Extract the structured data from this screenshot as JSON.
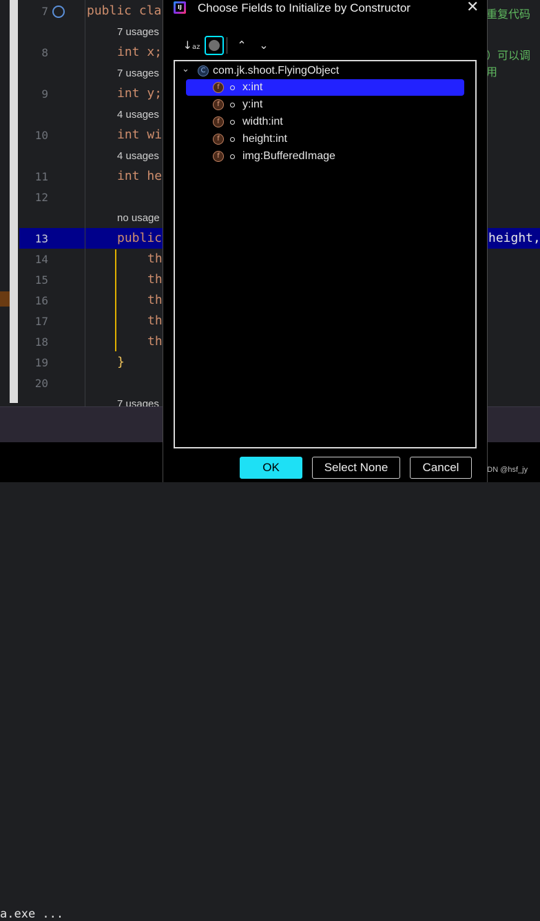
{
  "editor": {
    "lines": [
      {
        "no": "7",
        "code_kw": "public",
        "code_rest": " cla",
        "hint": null
      },
      {
        "no": "8",
        "code_kw": "int",
        "code_rest": " x;"
      },
      {
        "no": "9",
        "code_kw": "int",
        "code_rest": " y;"
      },
      {
        "no": "10",
        "code_kw": "int",
        "code_rest": " wi"
      },
      {
        "no": "11",
        "code_kw": "int",
        "code_rest": " he"
      },
      {
        "no": "12"
      },
      {
        "no": "13",
        "code_kw": "public",
        "code_rest": ""
      },
      {
        "no": "14",
        "code_rest": "th"
      },
      {
        "no": "15",
        "code_rest": "th"
      },
      {
        "no": "16",
        "code_rest": "th"
      },
      {
        "no": "17",
        "code_rest": "th"
      },
      {
        "no": "18",
        "code_rest": "th"
      },
      {
        "no": "19",
        "code_rest": "}"
      },
      {
        "no": "20"
      }
    ],
    "hints": [
      "7 usages",
      "7 usages",
      "4 usages",
      "4 usages",
      "no usage",
      "7 usages"
    ],
    "right_comment_1": "重复代码",
    "right_comment_2": "）可以调用",
    "right_code_13": "height,",
    "terminal_text": "a.exe ...",
    "watermark": "CSDN @hsf_jy"
  },
  "dialog": {
    "title": "Choose Fields to Initialize by Constructor",
    "toolbar": {
      "sort_icon": "sort-alpha-icon",
      "toggle_icon": "show-visibility-icon",
      "expand_icon": "expand-all-icon",
      "collapse_icon": "collapse-all-icon"
    },
    "tree": {
      "root_label": "com.jk.shoot.FlyingObject",
      "root_icon_letter": "C",
      "fields": [
        {
          "label": "x:int",
          "selected": true
        },
        {
          "label": "y:int",
          "selected": false
        },
        {
          "label": "width:int",
          "selected": false
        },
        {
          "label": "height:int",
          "selected": false
        },
        {
          "label": "img:BufferedImage",
          "selected": false
        }
      ],
      "field_icon_letter": "f"
    },
    "buttons": {
      "ok": "OK",
      "select_none": "Select None",
      "cancel": "Cancel"
    }
  },
  "colors": {
    "selection": "#2222ff",
    "ok_button": "#1ee0f5",
    "editor_highlight": "#00008b"
  }
}
